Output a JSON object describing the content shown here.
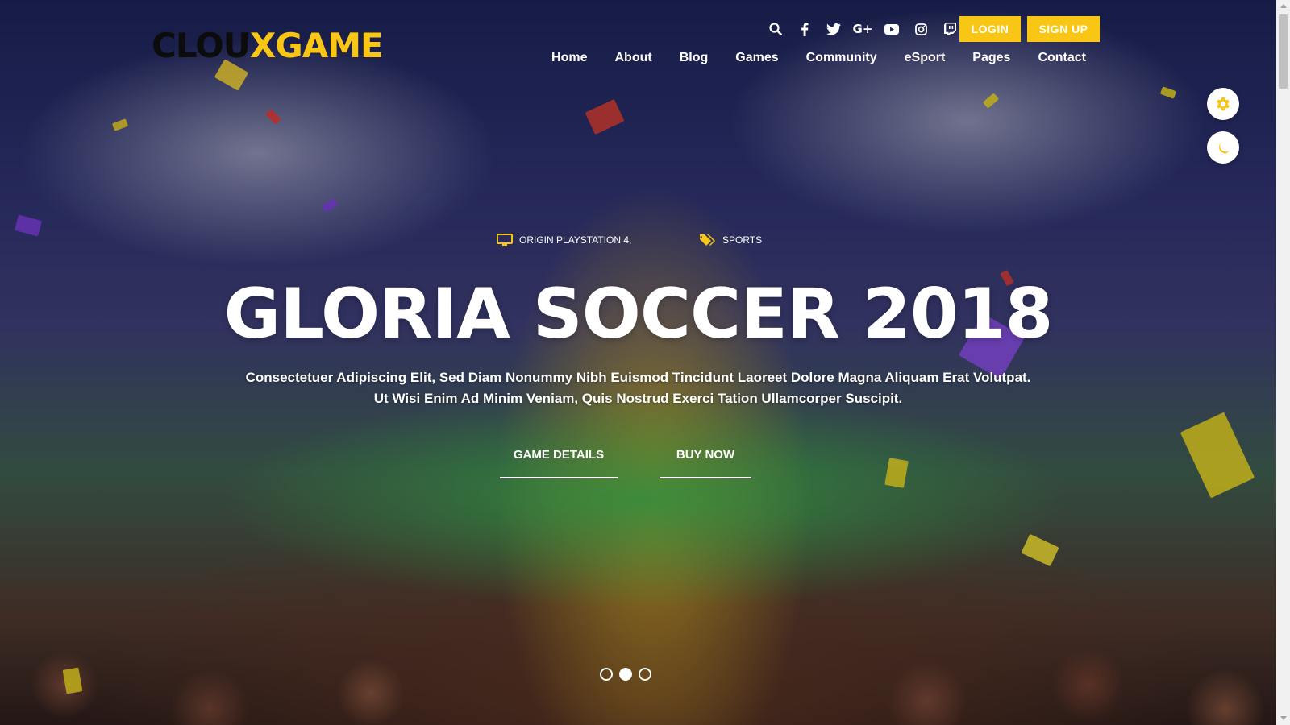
{
  "brand": {
    "logo_part1": "CLOU",
    "logo_part2": "XGAME",
    "accent_color": "#f9c616"
  },
  "header": {
    "social_icons": [
      "search-icon",
      "facebook-icon",
      "twitter-icon",
      "google-plus-icon",
      "youtube-icon",
      "instagram-icon",
      "twitch-icon"
    ],
    "login_label": "LOGIN",
    "signup_label": "SIGN UP"
  },
  "nav": {
    "items": [
      "Home",
      "About",
      "Blog",
      "Games",
      "Community",
      "eSport",
      "Pages",
      "Contact"
    ]
  },
  "side_buttons": [
    "gear-icon",
    "moon-icon"
  ],
  "hero": {
    "platform": "ORIGIN PLAYSTATION 4,",
    "genre": "SPORTS",
    "title": "GLORIA SOCCER 2018",
    "description_line1": "Consectetuer Adipiscing Elit, Sed Diam Nonummy Nibh Euismod Tincidunt Laoreet Dolore Magna Aliquam Erat Volutpat.",
    "description_line2": "Ut Wisi Enim Ad Minim Veniam, Quis Nostrud Exerci Tation Ullamcorper Suscipit.",
    "button_details": "GAME DETAILS",
    "button_buy": "BUY NOW",
    "slides": 3,
    "active_slide": 2
  }
}
